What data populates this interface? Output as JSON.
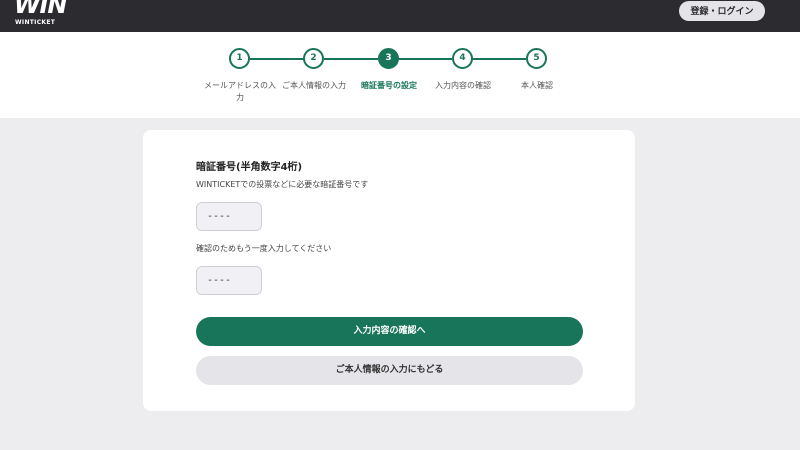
{
  "header": {
    "logo_text": "WIN",
    "logo_subtext": "WINTICKET",
    "login_label": "登録・ログイン"
  },
  "stepper": {
    "current_step": 3,
    "steps": [
      {
        "number": "1",
        "label": "メールアドレスの入力"
      },
      {
        "number": "2",
        "label": "ご本人情報の入力"
      },
      {
        "number": "3",
        "label": "暗証番号の設定"
      },
      {
        "number": "4",
        "label": "入力内容の確認"
      },
      {
        "number": "5",
        "label": "本人確認"
      }
    ]
  },
  "form": {
    "title": "暗証番号(半角数字4桁)",
    "description": "WINTICKETでの投票などに必要な暗証番号です",
    "pin_value": "----",
    "confirm_label": "確認のためもう一度入力してください",
    "confirm_value": "----",
    "primary_button": "入力内容の確認へ",
    "secondary_button": "ご本人情報の入力にもどる"
  },
  "colors": {
    "accent": "#187559",
    "header_bg": "#2c2c30",
    "page_bg": "#ededf0"
  }
}
